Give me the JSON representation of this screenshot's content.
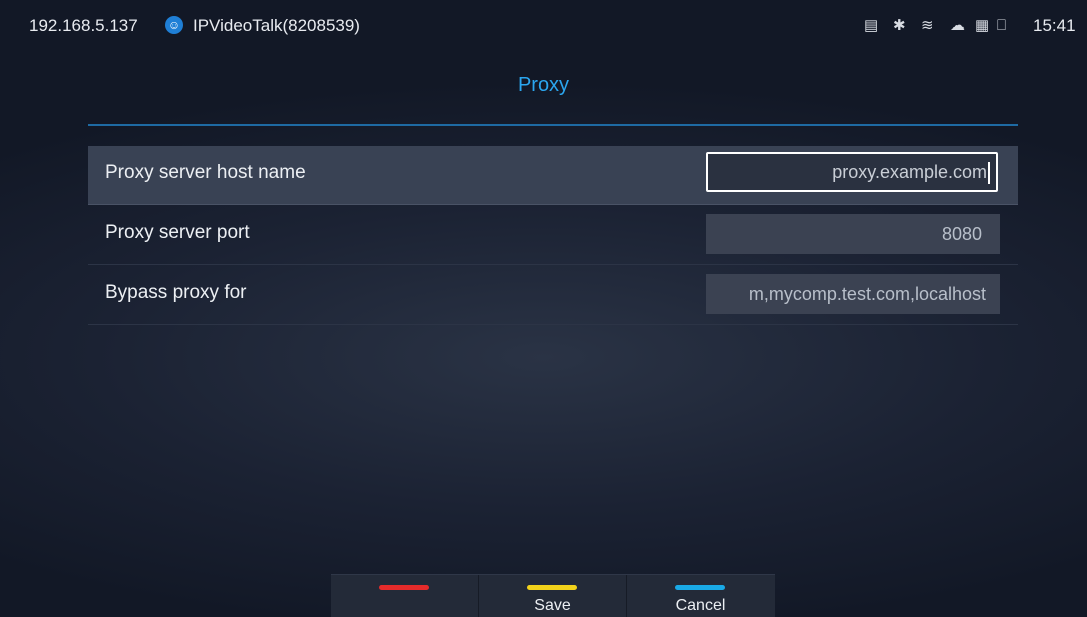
{
  "status_bar": {
    "ip": "192.168.5.137",
    "account": "IPVideoTalk(8208539)",
    "time": "15:41",
    "icons": [
      "screen-icon",
      "bluetooth-icon",
      "wifi-off-icon",
      "cloud-icon",
      "sd-card-icon",
      "ethernet-icon"
    ]
  },
  "page": {
    "title": "Proxy"
  },
  "settings": [
    {
      "label": "Proxy server host name",
      "value": "proxy.example.com"
    },
    {
      "label": "Proxy server port",
      "value": "8080"
    },
    {
      "label": "Bypass proxy for",
      "value": "m,mycomp.test.com,localhost"
    }
  ],
  "softkeys": [
    {
      "label": "",
      "color": "#e52b2b"
    },
    {
      "label": "Save",
      "color": "#f2d21b"
    },
    {
      "label": "Cancel",
      "color": "#19a9e6"
    }
  ],
  "colors": {
    "accent": "#2ba6ef",
    "background": "#1b2233"
  }
}
